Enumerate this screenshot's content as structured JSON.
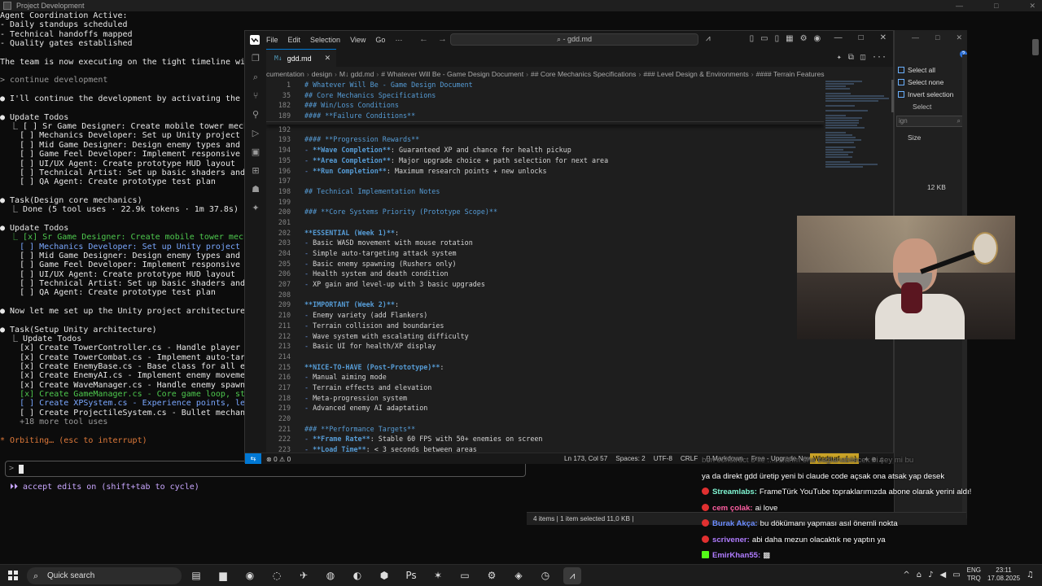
{
  "terminal": {
    "title": "Project Development",
    "lines": [
      {
        "t": "Agent Coordination Active:",
        "c": "white"
      },
      {
        "t": "- Daily standups scheduled",
        "c": "white"
      },
      {
        "t": "- Technical handoffs mapped",
        "c": "white"
      },
      {
        "t": "- Quality gates established",
        "c": "white"
      },
      {
        "t": "",
        "c": "white"
      },
      {
        "t": "The team is now executing on the tight timeline with c",
        "c": "white"
      },
      {
        "t": "",
        "c": "white"
      },
      {
        "t": "> continue development",
        "c": "gray"
      },
      {
        "t": "",
        "c": "white"
      },
      {
        "t": "● I'll continue the development by activating the key ag",
        "c": "white"
      },
      {
        "t": "",
        "c": "white"
      },
      {
        "t": "● Update Todos",
        "c": "white"
      },
      {
        "t": "  ⎿ [ ] Sr Game Designer: Create mobile tower mechanics",
        "c": "white"
      },
      {
        "t": "    [ ] Mechanics Developer: Set up Unity project archi",
        "c": "white"
      },
      {
        "t": "    [ ] Mid Game Designer: Design enemy types and wave",
        "c": "white"
      },
      {
        "t": "    [ ] Game Feel Developer: Implement responsive tower",
        "c": "white"
      },
      {
        "t": "    [ ] UI/UX Agent: Create prototype HUD layout",
        "c": "white"
      },
      {
        "t": "    [ ] Technical Artist: Set up basic shaders and visu",
        "c": "white"
      },
      {
        "t": "    [ ] QA Agent: Create prototype test plan",
        "c": "white"
      },
      {
        "t": "",
        "c": "white"
      },
      {
        "t": "● Task(Design core mechanics)",
        "c": "white"
      },
      {
        "t": "  ⎿ Done (5 tool uses · 22.9k tokens · 1m 37.8s)",
        "c": "white"
      },
      {
        "t": "",
        "c": "white"
      },
      {
        "t": "● Update Todos",
        "c": "white"
      },
      {
        "t": "  ⎿ [x] Sr Game Designer: Create mobile tower mechanics",
        "c": "green"
      },
      {
        "t": "    [ ] Mechanics Developer: Set up Unity project archi",
        "c": "blue"
      },
      {
        "t": "    [ ] Mid Game Designer: Design enemy types and wave",
        "c": "white"
      },
      {
        "t": "    [ ] Game Feel Developer: Implement responsive tower",
        "c": "white"
      },
      {
        "t": "    [ ] UI/UX Agent: Create prototype HUD layout",
        "c": "white"
      },
      {
        "t": "    [ ] Technical Artist: Set up basic shaders and visu",
        "c": "white"
      },
      {
        "t": "    [ ] QA Agent: Create prototype test plan",
        "c": "white"
      },
      {
        "t": "",
        "c": "white"
      },
      {
        "t": "● Now let me set up the Unity project architecture:",
        "c": "white"
      },
      {
        "t": "",
        "c": "white"
      },
      {
        "t": "● Task(Setup Unity architecture)",
        "c": "white"
      },
      {
        "t": "  ⎿ Update Todos",
        "c": "white"
      },
      {
        "t": "    [x] Create TowerController.cs - Handle player movem",
        "c": "white"
      },
      {
        "t": "    [x] Create TowerCombat.cs - Implement auto-targetin",
        "c": "white"
      },
      {
        "t": "    [x] Create EnemyBase.cs - Base class for all enemy",
        "c": "white"
      },
      {
        "t": "    [x] Create EnemyAI.cs - Implement enemy movement pa",
        "c": "white"
      },
      {
        "t": "    [x] Create WaveManager.cs - Handle enemy spawning,",
        "c": "white"
      },
      {
        "t": "    [x] Create GameManager.cs - Core game loop, state m",
        "c": "green"
      },
      {
        "t": "    [ ] Create XPSystem.cs - Experience points, levelin",
        "c": "blue"
      },
      {
        "t": "    [ ] Create ProjectileSystem.cs - Bullet mechanics,",
        "c": "white"
      },
      {
        "t": "    +18 more tool uses",
        "c": "gray"
      },
      {
        "t": "",
        "c": "white"
      },
      {
        "t": "* Orbiting… (esc to interrupt)",
        "c": "orange"
      }
    ],
    "prompt_arrow": ">",
    "footer": "⏵⏵ accept edits on (shift+tab to cycle)"
  },
  "editor": {
    "menu": [
      "File",
      "Edit",
      "Selection",
      "View",
      "Go",
      "···"
    ],
    "command_center": "⌕ - gdd.md",
    "tab": {
      "label": "gdd.md",
      "icon": "M↓"
    },
    "breadcrumb": [
      "cumentation",
      "design",
      "M↓ gdd.md",
      "# Whatever Will Be - Game Design Document",
      "## Core Mechanics Specifications",
      "### Level Design & Environments",
      "#### Terrain Features"
    ],
    "lines": [
      {
        "n": "1",
        "s": true,
        "p": [
          [
            "h",
            "# Whatever Will Be - Game Design Document"
          ]
        ]
      },
      {
        "n": "35",
        "s": true,
        "p": [
          [
            "h",
            "## Core Mechanics Specifications"
          ]
        ]
      },
      {
        "n": "182",
        "s": true,
        "p": [
          [
            "h",
            "### Win/Loss Conditions"
          ]
        ]
      },
      {
        "n": "189",
        "s": true,
        "p": [
          [
            "h",
            "#### **Failure Conditions**"
          ]
        ]
      },
      {
        "n": "192",
        "p": []
      },
      {
        "n": "193",
        "p": [
          [
            "h",
            "#### **Progression Rewards**"
          ]
        ]
      },
      {
        "n": "194",
        "p": [
          [
            "d",
            "- "
          ],
          [
            "b",
            "**Wave Completion**"
          ],
          [
            "t",
            ": Guaranteed XP and chance for health pickup"
          ]
        ]
      },
      {
        "n": "195",
        "p": [
          [
            "d",
            "- "
          ],
          [
            "b",
            "**Area Completion**"
          ],
          [
            "t",
            ": Major upgrade choice + path selection for next area"
          ]
        ]
      },
      {
        "n": "196",
        "p": [
          [
            "d",
            "- "
          ],
          [
            "b",
            "**Run Completion**"
          ],
          [
            "t",
            ": Maximum research points + new unlocks"
          ]
        ]
      },
      {
        "n": "197",
        "p": []
      },
      {
        "n": "198",
        "p": [
          [
            "h",
            "## Technical Implementation Notes"
          ]
        ]
      },
      {
        "n": "199",
        "p": []
      },
      {
        "n": "200",
        "p": [
          [
            "h",
            "### **Core Systems Priority (Prototype Scope)**"
          ]
        ]
      },
      {
        "n": "201",
        "p": []
      },
      {
        "n": "202",
        "p": [
          [
            "b",
            "**ESSENTIAL (Week 1)**"
          ],
          [
            "t",
            ":"
          ]
        ]
      },
      {
        "n": "203",
        "p": [
          [
            "d",
            "- "
          ],
          [
            "t",
            "Basic WASD movement with mouse rotation"
          ]
        ]
      },
      {
        "n": "204",
        "p": [
          [
            "d",
            "- "
          ],
          [
            "t",
            "Simple auto-targeting attack system"
          ]
        ]
      },
      {
        "n": "205",
        "p": [
          [
            "d",
            "- "
          ],
          [
            "t",
            "Basic enemy spawning (Rushers only)"
          ]
        ]
      },
      {
        "n": "206",
        "p": [
          [
            "d",
            "- "
          ],
          [
            "t",
            "Health system and death condition"
          ]
        ]
      },
      {
        "n": "207",
        "p": [
          [
            "d",
            "- "
          ],
          [
            "t",
            "XP gain and level-up with 3 basic upgrades"
          ]
        ]
      },
      {
        "n": "208",
        "p": []
      },
      {
        "n": "209",
        "p": [
          [
            "b",
            "**IMPORTANT (Week 2)**"
          ],
          [
            "t",
            ":"
          ]
        ]
      },
      {
        "n": "210",
        "p": [
          [
            "d",
            "- "
          ],
          [
            "t",
            "Enemy variety (add Flankers)"
          ]
        ]
      },
      {
        "n": "211",
        "p": [
          [
            "d",
            "- "
          ],
          [
            "t",
            "Terrain collision and boundaries"
          ]
        ]
      },
      {
        "n": "212",
        "p": [
          [
            "d",
            "- "
          ],
          [
            "t",
            "Wave system with escalating difficulty"
          ]
        ]
      },
      {
        "n": "213",
        "p": [
          [
            "d",
            "- "
          ],
          [
            "t",
            "Basic UI for health/XP display"
          ]
        ]
      },
      {
        "n": "214",
        "p": []
      },
      {
        "n": "215",
        "p": [
          [
            "b",
            "**NICE-TO-HAVE (Post-Prototype)**"
          ],
          [
            "t",
            ":"
          ]
        ]
      },
      {
        "n": "216",
        "p": [
          [
            "d",
            "- "
          ],
          [
            "t",
            "Manual aiming mode"
          ]
        ]
      },
      {
        "n": "217",
        "p": [
          [
            "d",
            "- "
          ],
          [
            "t",
            "Terrain effects and elevation"
          ]
        ]
      },
      {
        "n": "218",
        "p": [
          [
            "d",
            "- "
          ],
          [
            "t",
            "Meta-progression system"
          ]
        ]
      },
      {
        "n": "219",
        "p": [
          [
            "d",
            "- "
          ],
          [
            "t",
            "Advanced enemy AI adaptation"
          ]
        ]
      },
      {
        "n": "220",
        "p": []
      },
      {
        "n": "221",
        "p": [
          [
            "h",
            "### **Performance Targets**"
          ]
        ]
      },
      {
        "n": "222",
        "p": [
          [
            "d",
            "- "
          ],
          [
            "b",
            "**Frame Rate**"
          ],
          [
            "t",
            ": Stable 60 FPS with 50+ enemies on screen"
          ]
        ]
      },
      {
        "n": "223",
        "p": [
          [
            "d",
            "- "
          ],
          [
            "b",
            "**Load Time**"
          ],
          [
            "t",
            ": < 3 seconds between areas"
          ]
        ]
      }
    ],
    "status": {
      "problems": "⊗ 0 ⚠ 0",
      "position": "Ln 173, Col 57",
      "spaces": "Spaces: 2",
      "encoding": "UTF-8",
      "eol": "CRLF",
      "language": "{} Markdown",
      "upgrade": "Free - Upgrade Now",
      "windsurf": "Windsurf - {…}",
      "extra": "✦ ⊕ ♫"
    }
  },
  "explorer": {
    "ribbon": [
      "Select all",
      "Select none",
      "Invert selection"
    ],
    "group_label": "Select",
    "search_placeholder": "ign",
    "size_header": "Size",
    "size_value": "12 KB",
    "status": "4 items  |  1 item selected  11,0 KB  |"
  },
  "chat": [
    {
      "user": "",
      "msg": "ben construct 3 ile ........arım ona bağlanabilecek bi şey mi bu",
      "fade": true,
      "badge": "",
      "color": "#888888"
    },
    {
      "user": "",
      "msg": "ya da direkt gdd üretip yeni bi claude code açsak ona atsak yap desek",
      "fade": false,
      "badge": "",
      "color": "#ffffff"
    },
    {
      "user": "Streamlabs:",
      "msg": "FrameTürk YouTube topraklarımızda abone olarak yerini aldı!",
      "fade": false,
      "badge": "r",
      "color": "#80f5d2"
    },
    {
      "user": "cem çolak:",
      "msg": "ai love",
      "fade": false,
      "badge": "r",
      "color": "#ff5fa2"
    },
    {
      "user": "Burak Akça:",
      "msg": "bu dökümanı yapması asıl önemli nokta",
      "fade": false,
      "badge": "r",
      "color": "#6b8cff"
    },
    {
      "user": "scrivener:",
      "msg": "abi daha mezun olacaktık ne yaptın ya",
      "fade": false,
      "badge": "r",
      "color": "#b07cff"
    },
    {
      "user": "EmirKhan55:",
      "msg": "▩",
      "fade": false,
      "badge": "k",
      "color": "#b07cff"
    }
  ],
  "taskbar": {
    "search": "Quick search",
    "apps": [
      "▤",
      "▆",
      "◉",
      "◌",
      "✈",
      "◍",
      "◐",
      "⬢",
      "Ps",
      "✶",
      "▭",
      "⚙",
      "◈",
      "◷",
      "⩘"
    ],
    "lang": [
      "ENG",
      "TRQ"
    ],
    "time": "23:11",
    "date": "17.08.2025"
  },
  "colors": {
    "accent": "#0078d4",
    "windsurf": "#c9a227",
    "heading": "#569cd6"
  }
}
